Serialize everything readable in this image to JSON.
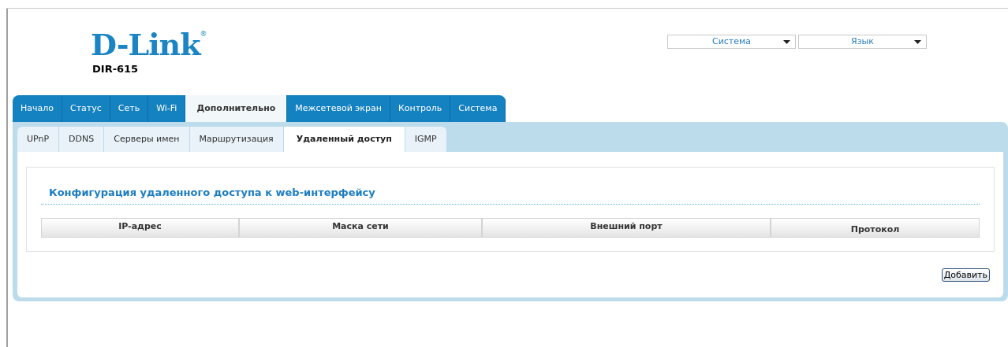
{
  "header": {
    "logo": "D-Link",
    "logo_mark": "®",
    "model": "DIR-615",
    "dropdowns": [
      "Система",
      "Язык"
    ]
  },
  "tabs": [
    {
      "label": "Начало",
      "selected": false
    },
    {
      "label": "Статус",
      "selected": false
    },
    {
      "label": "Сеть",
      "selected": false
    },
    {
      "label": "Wi-Fi",
      "selected": false
    },
    {
      "label": "Дополнительно",
      "selected": true
    },
    {
      "label": "Межсетевой экран",
      "selected": false
    },
    {
      "label": "Контроль",
      "selected": false
    },
    {
      "label": "Система",
      "selected": false
    }
  ],
  "subtabs": [
    {
      "label": "UPnP",
      "selected": false
    },
    {
      "label": "DDNS",
      "selected": false
    },
    {
      "label": "Серверы имен",
      "selected": false
    },
    {
      "label": "Маршрутизация",
      "selected": false
    },
    {
      "label": "Удаленный доступ",
      "selected": true
    },
    {
      "label": "IGMP",
      "selected": false
    }
  ],
  "section_title": "Конфигурация удаленного доступа к web-интерфейсу",
  "table": {
    "columns": [
      "IP-адрес",
      "Маска сети",
      "Внешний порт",
      "Протокол"
    ]
  },
  "buttons": [
    "Добавить"
  ]
}
